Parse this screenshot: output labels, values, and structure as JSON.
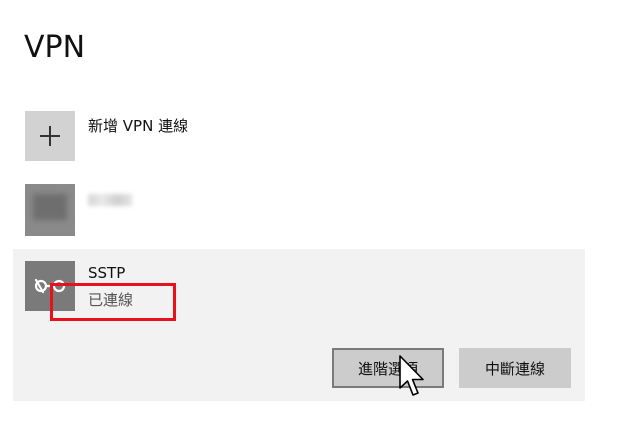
{
  "header": {
    "title": "VPN"
  },
  "add_connection": {
    "label": "新增 VPN 連線",
    "icon": "plus-icon"
  },
  "connections": [
    {
      "name": "",
      "status": "",
      "icon": "vpn-network-icon",
      "obscured": true
    },
    {
      "name": "SSTP",
      "status": "已連線",
      "icon": "vpn-connection-icon",
      "selected": true
    }
  ],
  "actions": {
    "advanced_label": "進階選項",
    "disconnect_label": "中斷連線"
  },
  "annotation": {
    "highlight_color": "#e8101a"
  },
  "colors": {
    "tile_gray": "#d2d2d2",
    "selected_bg": "#f2f2f2",
    "button_bg": "#cccccc"
  }
}
